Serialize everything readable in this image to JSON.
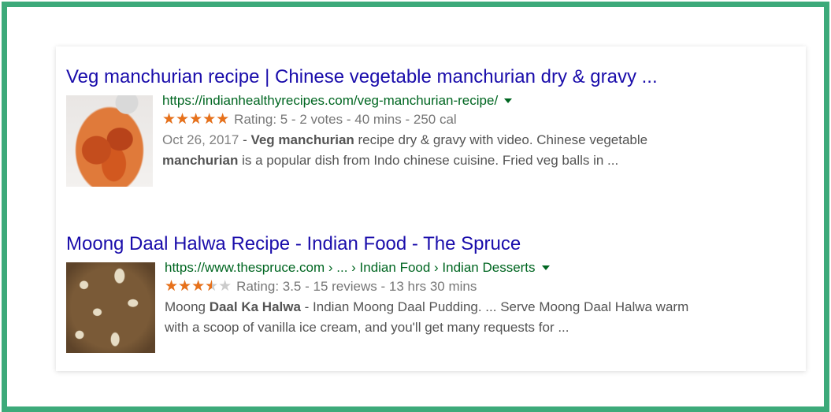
{
  "colors": {
    "frame_border": "#3daa7a",
    "title_link": "#1a0dab",
    "url_green": "#006621",
    "star_orange": "#e7711b",
    "star_empty": "#cccccc",
    "snippet_text": "#545454"
  },
  "results": [
    {
      "title": "Veg manchurian recipe | Chinese vegetable manchurian dry & gravy ...",
      "url": "https://indianhealthyrecipes.com/veg-manchurian-recipe/",
      "rating_value": 5,
      "rating_max": 5,
      "rating_text": "Rating: 5 - 2 votes - 40 mins - 250 cal",
      "thumbnail_icon": "veg-manchurian-dish-image",
      "snippet": {
        "date": "Oct 26, 2017",
        "sep": " - ",
        "line1_b1": "Veg ",
        "line1_b2": "manchurian",
        "line1_rest": " recipe dry & gravy with video. Chinese vegetable",
        "line2_b": "manchurian",
        "line2_rest": " is a popular dish from Indo chinese cuisine. Fried veg balls in ..."
      }
    },
    {
      "title": "Moong Daal Halwa Recipe - Indian Food - The Spruce",
      "url": "https://www.thespruce.com › ... › Indian Food › Indian Desserts",
      "rating_value": 3.5,
      "rating_max": 5,
      "rating_text": "Rating: 3.5 - 15 reviews - 13 hrs 30 mins",
      "thumbnail_icon": "moong-daal-halwa-image",
      "snippet": {
        "p1": "Moong ",
        "b1": "Daal Ka Halwa",
        "p2": " - Indian Moong Daal Pudding. ... Serve Moong Daal Halwa warm",
        "line2": "with a scoop of vanilla ice cream, and you'll get many requests for ..."
      }
    }
  ]
}
